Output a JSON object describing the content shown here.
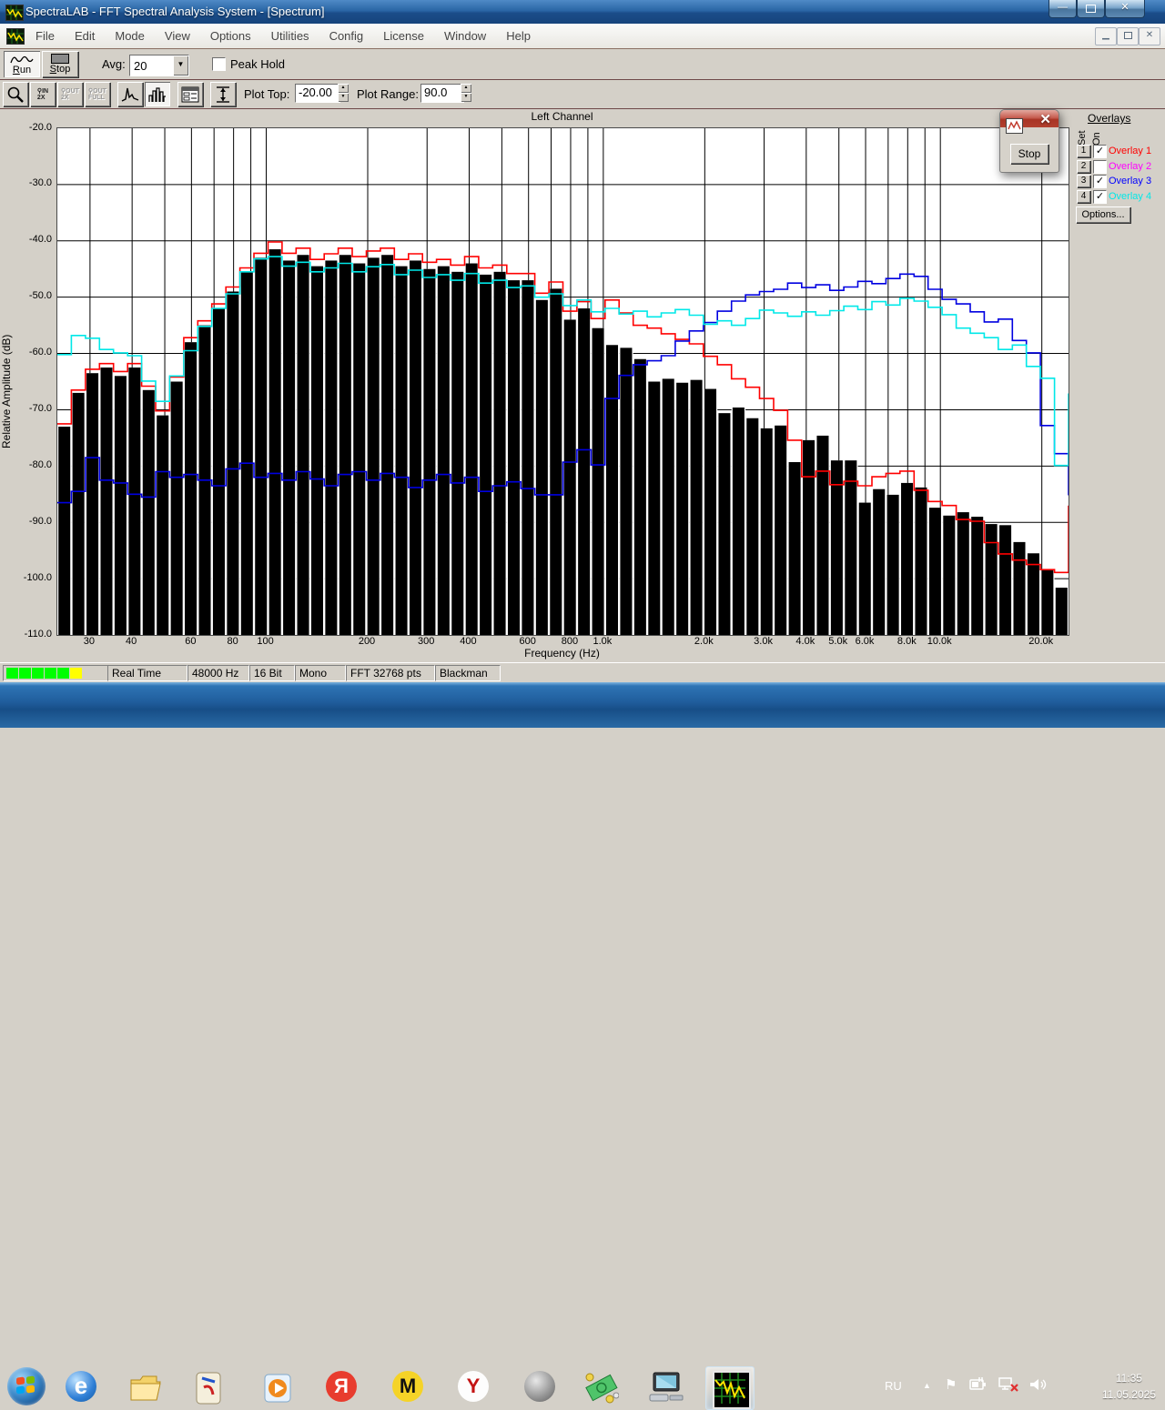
{
  "window": {
    "title": "SpectraLAB - FFT Spectral Analysis System - [Spectrum]",
    "menu_items": [
      "File",
      "Edit",
      "Mode",
      "View",
      "Options",
      "Utilities",
      "Config",
      "License",
      "Window",
      "Help"
    ]
  },
  "toolbar": {
    "run_label": "Run",
    "stop_label": "Stop",
    "avg_label": "Avg:",
    "avg_value": "20",
    "peak_hold_label": "Peak Hold",
    "zoom_in_top": "IN",
    "zoom_in_bottom": "2X",
    "zoom_out_top": "OUT",
    "zoom_out_bottom": "2X",
    "zoom_full_top": "OUT",
    "zoom_full_bottom": "FULL",
    "plot_top_label": "Plot Top:",
    "plot_top_value": "-20.00",
    "plot_range_label": "Plot Range:",
    "plot_range_value": "90.0"
  },
  "chart_data": {
    "type": "bar",
    "title": "Left Channel",
    "xlabel": "Frequency (Hz)",
    "ylabel": "Relative Amplitude (dB)",
    "xscale": "log",
    "fmin": 24,
    "fmax": 24000,
    "ylim": [
      -110,
      -20
    ],
    "grid": true,
    "grid_freqs": [
      30,
      40,
      50,
      60,
      70,
      80,
      90,
      100,
      200,
      300,
      400,
      500,
      600,
      700,
      800,
      900,
      1000,
      2000,
      3000,
      4000,
      5000,
      6000,
      7000,
      8000,
      9000,
      10000,
      20000
    ],
    "xticks": [
      {
        "f": 30,
        "label": "30"
      },
      {
        "f": 40,
        "label": "40"
      },
      {
        "f": 60,
        "label": "60"
      },
      {
        "f": 80,
        "label": "80"
      },
      {
        "f": 100,
        "label": "100"
      },
      {
        "f": 200,
        "label": "200"
      },
      {
        "f": 300,
        "label": "300"
      },
      {
        "f": 400,
        "label": "400"
      },
      {
        "f": 600,
        "label": "600"
      },
      {
        "f": 800,
        "label": "800"
      },
      {
        "f": 1000,
        "label": "1.0k"
      },
      {
        "f": 2000,
        "label": "2.0k"
      },
      {
        "f": 3000,
        "label": "3.0k"
      },
      {
        "f": 4000,
        "label": "4.0k"
      },
      {
        "f": 5000,
        "label": "5.0k"
      },
      {
        "f": 6000,
        "label": "6.0k"
      },
      {
        "f": 8000,
        "label": "8.0k"
      },
      {
        "f": 10000,
        "label": "10.0k"
      },
      {
        "f": 20000,
        "label": "20.0k"
      }
    ],
    "yticks": [
      "-20.0",
      "-30.0",
      "-40.0",
      "-50.0",
      "-60.0",
      "-70.0",
      "-80.0",
      "-90.0",
      "-100.0",
      "-110.0"
    ],
    "bars": {
      "color": "#000000",
      "values": [
        -73,
        -67,
        -63.5,
        -62.5,
        -64,
        -62.5,
        -66.5,
        -71,
        -65,
        -58,
        -55,
        -52,
        -49,
        -45.5,
        -43,
        -41.5,
        -43.5,
        -42.5,
        -44.5,
        -43.5,
        -42.5,
        -44,
        -43,
        -42.5,
        -44.5,
        -43.5,
        -45,
        -44.5,
        -45.5,
        -44,
        -46,
        -45.5,
        -47,
        -47,
        -50.5,
        -48.5,
        -54,
        -52,
        -55.5,
        -58.5,
        -59,
        -61,
        -65,
        -64.5,
        -65.2,
        -64.7,
        -66.3,
        -70.6,
        -69.6,
        -71.5,
        -73.3,
        -72.8,
        -79.3,
        -75.4,
        -74.6,
        -79,
        -79,
        -86.5,
        -84.1,
        -85.1,
        -83,
        -83.8,
        -87.4,
        -88.8,
        -88.2,
        -89,
        -90.3,
        -90.5,
        -93.5,
        -95.5,
        -98.5,
        -101.6
      ]
    },
    "overlays": [
      {
        "name": "Overlay 1",
        "color": "#ff0000",
        "visible": true,
        "tail": -87,
        "values": [
          -72.5,
          -66.5,
          -62.8,
          -61.8,
          -63.2,
          -61.8,
          -65.8,
          -70.2,
          -64.2,
          -57.2,
          -54.2,
          -51.2,
          -48.2,
          -44.8,
          -42.2,
          -40.2,
          -42.2,
          -41.3,
          -43.3,
          -42.3,
          -41.3,
          -42.8,
          -41.8,
          -41.3,
          -43.3,
          -42.3,
          -43.8,
          -43.3,
          -44.3,
          -42.8,
          -44.8,
          -44.3,
          -45.8,
          -45.8,
          -49.3,
          -47.3,
          -52.5,
          -50.8,
          -53.8,
          -50.5,
          -52.8,
          -55,
          -55.5,
          -56.5,
          -57.5,
          -58.3,
          -60.5,
          -62,
          -64.5,
          -66,
          -68,
          -70.1,
          -75.4,
          -81.9,
          -80.9,
          -83.3,
          -82.7,
          -83.5,
          -81.9,
          -81.3,
          -80.9,
          -84.3,
          -86.3,
          -87,
          -89.5,
          -89.8,
          -93.6,
          -95.6,
          -96.7,
          -97.5,
          -98.4,
          -98.9
        ]
      },
      {
        "name": "Overlay 2",
        "color": "#ff00ff",
        "visible": false,
        "tail": null,
        "values": []
      },
      {
        "name": "Overlay 3",
        "color": "#0000e0",
        "visible": true,
        "tail": -85.2,
        "values": [
          -86.5,
          -84.5,
          -78.5,
          -82.5,
          -83,
          -85,
          -85.5,
          -81,
          -82,
          -81.5,
          -82.5,
          -83.5,
          -80.5,
          -79.5,
          -82,
          -81.3,
          -82.5,
          -81,
          -82.3,
          -83.5,
          -81.5,
          -81,
          -82.5,
          -81.3,
          -82,
          -83.8,
          -82.5,
          -81.5,
          -83,
          -82,
          -84.5,
          -83.5,
          -82.8,
          -84,
          -85.1,
          -85.1,
          -79.3,
          -77.1,
          -79.8,
          -68,
          -63.9,
          -62,
          -61.3,
          -60.4,
          -57.8,
          -56,
          -54.5,
          -52.5,
          -50.7,
          -49.6,
          -49,
          -48.6,
          -47.5,
          -48.3,
          -47.8,
          -48.8,
          -48.2,
          -47.2,
          -47.6,
          -46.7,
          -45.9,
          -46.3,
          -48.6,
          -50.4,
          -51.2,
          -52.6,
          -54.4,
          -53.9,
          -57.7,
          -59.9,
          -72.8,
          -77.8
        ]
      },
      {
        "name": "Overlay 4",
        "color": "#00e8e8",
        "visible": true,
        "tail": -67.1,
        "values": [
          -60.2,
          -56.8,
          -57.3,
          -59.3,
          -59.9,
          -60.4,
          -64.9,
          -68.5,
          -64,
          -59.5,
          -55.2,
          -52,
          -49.4,
          -45.5,
          -43.2,
          -42.8,
          -44.5,
          -43.8,
          -45.5,
          -44.8,
          -44,
          -45.5,
          -44.6,
          -44.2,
          -46,
          -45.2,
          -46.5,
          -46,
          -47,
          -45.8,
          -47.5,
          -47,
          -48.3,
          -48,
          -50,
          -49.4,
          -51.5,
          -50.5,
          -52.6,
          -52,
          -53,
          -52.5,
          -53.5,
          -52.8,
          -52.2,
          -53.2,
          -54.8,
          -54.2,
          -55,
          -53.8,
          -52.3,
          -52.8,
          -53.4,
          -52.6,
          -53.2,
          -52.4,
          -51.6,
          -52.2,
          -50.8,
          -51.4,
          -50.2,
          -50.7,
          -51.8,
          -53.1,
          -55.5,
          -56.4,
          -57.2,
          -59.3,
          -58.5,
          -62.3,
          -64.4,
          -79.9
        ]
      }
    ]
  },
  "overlays_panel": {
    "title": "Overlays",
    "set_label": "Set",
    "on_label": "On",
    "rows": [
      {
        "num": "1",
        "label": "Overlay 1",
        "color": "#ff0000",
        "checked": true
      },
      {
        "num": "2",
        "label": "Overlay 2",
        "color": "#ff00ff",
        "checked": false
      },
      {
        "num": "3",
        "label": "Overlay 3",
        "color": "#0000ff",
        "checked": true
      },
      {
        "num": "4",
        "label": "Overlay 4",
        "color": "#00e8e8",
        "checked": true
      }
    ],
    "options_label": "Options..."
  },
  "mini_window": {
    "stop_label": "Stop"
  },
  "status_bar": {
    "meter_colors": [
      "#00ff00",
      "#00ff00",
      "#00ff00",
      "#00ff00",
      "#00ff00",
      "#ffff00"
    ],
    "cells": [
      "Real Time",
      "48000 Hz",
      "16 Bit",
      "Mono",
      "FFT 32768 pts",
      "Blackman"
    ]
  },
  "taskbar": {
    "language": "RU",
    "time": "11:35",
    "date": "11.05.2025",
    "logo_letters": {
      "ie": "e",
      "yandex": "Я",
      "metro": "M",
      "browser": "Y"
    }
  }
}
